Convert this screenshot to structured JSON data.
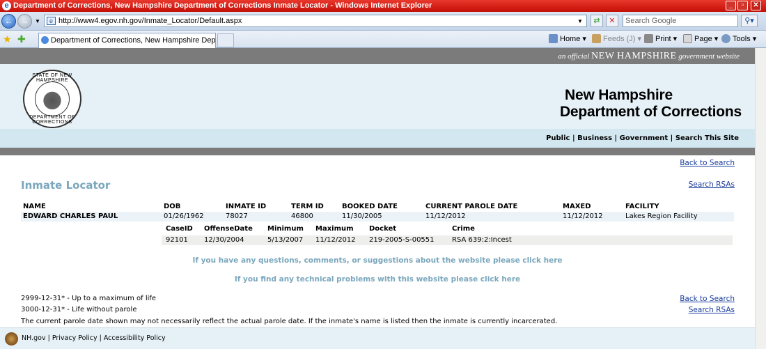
{
  "browser": {
    "title": "Department of Corrections, New Hampshire Department of Corrections Inmate Locator - Windows Internet Explorer",
    "url": "http://www4.egov.nh.gov/Inmate_Locator/Default.aspx",
    "search_placeholder": "Search Google",
    "tab_title": "Department of Corrections, New Hampshire Department...",
    "commands": {
      "home": "Home",
      "feeds": "Feeds (J)",
      "print": "Print",
      "page": "Page",
      "tools": "Tools"
    }
  },
  "site": {
    "official_prefix": "an official",
    "official_state": "NEW HAMPSHIRE",
    "official_suffix": "government website",
    "seal_top": "STATE OF NEW HAMPSHIRE",
    "seal_bottom": "DEPARTMENT OF CORRECTIONS",
    "dept_line1": "New Hampshire",
    "dept_line2": "Department of Corrections",
    "nav": [
      "Public",
      "Business",
      "Government",
      "Search This Site"
    ]
  },
  "content": {
    "back_to_search": "Back to Search",
    "search_rsas": "Search RSAs",
    "page_title": "Inmate Locator",
    "table_headers": {
      "name": "NAME",
      "dob": "DOB",
      "inmate_id": "INMATE ID",
      "term_id": "TERM ID",
      "booked_date": "BOOKED DATE",
      "current_parole_date": "CURRENT PAROLE DATE",
      "maxed": "MAXED",
      "facility": "FACILITY"
    },
    "inmate": {
      "name": "EDWARD CHARLES PAUL",
      "dob": "01/26/1962",
      "inmate_id": "78027",
      "term_id": "46800",
      "booked_date": "11/30/2005",
      "current_parole_date": "11/12/2012",
      "maxed": "11/12/2012",
      "facility": "Lakes Region Facility"
    },
    "case_headers": {
      "case_id": "CaseID",
      "offense_date": "OffenseDate",
      "minimum": "Minimum",
      "maximum": "Maximum",
      "docket": "Docket",
      "crime": "Crime"
    },
    "case": {
      "case_id": "92101",
      "offense_date": "12/30/2004",
      "minimum": "5/13/2007",
      "maximum": "11/12/2012",
      "docket": "219-2005-S-00551",
      "crime": "RSA 639:2:Incest"
    },
    "msg_questions": "If you have any questions, comments, or suggestions about the website please click here",
    "msg_technical": "If you find any technical problems with this website please click here",
    "note1": "2999-12-31* - Up to a maximum of life",
    "note2": "3000-12-31* - Life without parole",
    "note3": "The current parole date shown may not necessarily reflect the actual parole date. If the inmate's name is listed then the inmate is currently incarcerated."
  },
  "footer": {
    "links": [
      "NH.gov",
      "Privacy Policy",
      "Accessibility Policy"
    ]
  },
  "colors": {
    "title_bar": "#d0190f",
    "heading_accent": "#7aa7bd",
    "header_bg": "#e6f1f7",
    "band_grey": "#7b7b7b"
  }
}
